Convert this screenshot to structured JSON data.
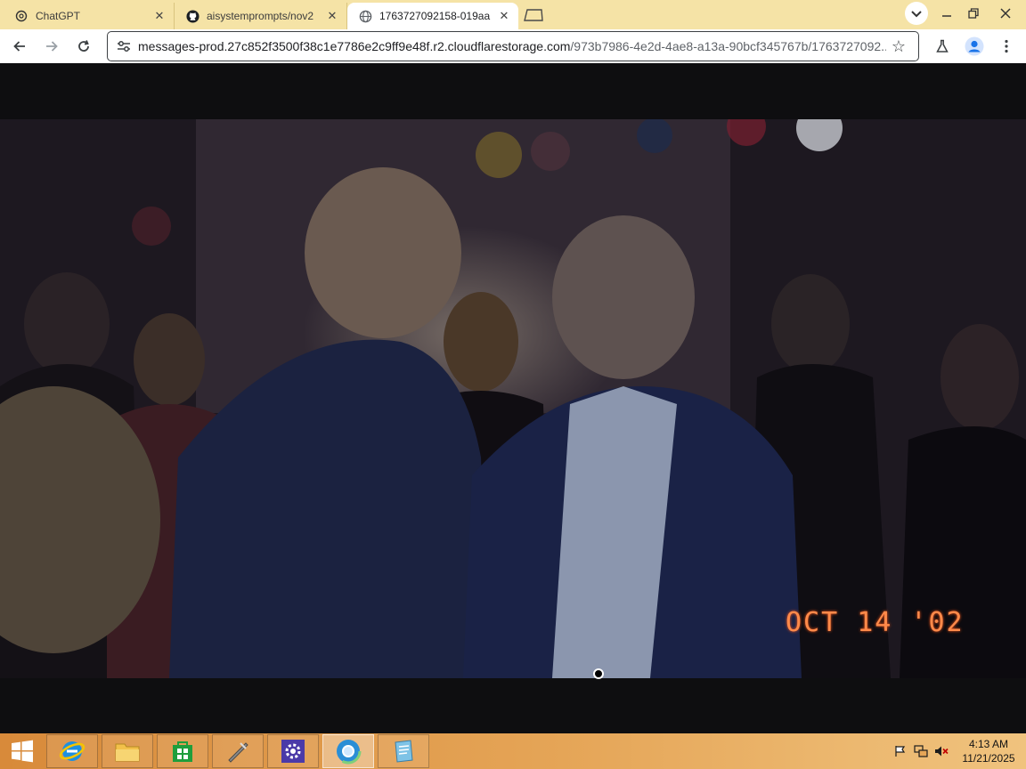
{
  "browser": {
    "tabs": [
      {
        "title": "ChatGPT",
        "icon": "openai-icon",
        "active": false
      },
      {
        "title": "aisystemprompts/nov2",
        "icon": "github-icon",
        "active": false
      },
      {
        "title": "1763727092158-019aa",
        "icon": "globe-icon",
        "active": true
      }
    ],
    "url": {
      "host": "messages-prod.27c852f3500f38c1e7786e2c9ff9e48f.r2.cloudflarestorage.com",
      "path": "/973b7986-4e2d-4ae8-a13a-90bcf345767b/1763727092..."
    },
    "accent": "#f5e3a6"
  },
  "photo": {
    "datestamp": "OCT 14 '02"
  },
  "taskbar": {
    "apps": [
      "start-icon",
      "internet-explorer-icon",
      "file-explorer-icon",
      "store-icon",
      "tool-icon",
      "settings-icon",
      "chrome-icon",
      "document-icon"
    ],
    "clock": {
      "time": "4:13 AM",
      "date": "11/21/2025"
    }
  }
}
